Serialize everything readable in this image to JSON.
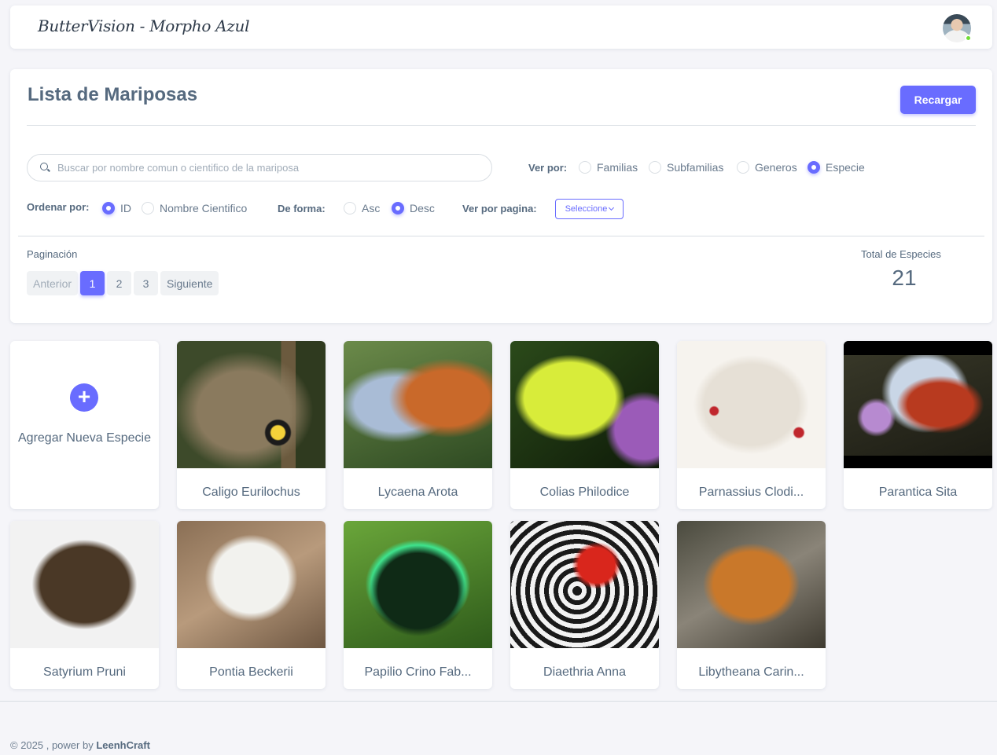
{
  "navbar": {
    "brand": "ButterVision - Morpho Azul"
  },
  "card": {
    "title": "Lista de Mariposas",
    "reload_label": "Recargar",
    "search_placeholder": "Buscar por nombre comun o cientifico de la mariposa",
    "search_value": "",
    "view_by": {
      "label": "Ver por:",
      "options": [
        "Familias",
        "Subfamilias",
        "Generos",
        "Especie"
      ],
      "selected": "Especie"
    },
    "order_by": {
      "label": "Ordenar por:",
      "options": [
        "ID",
        "Nombre Cientifico"
      ],
      "selected": "ID"
    },
    "direction": {
      "label": "De forma:",
      "options": [
        "Asc",
        "Desc"
      ],
      "selected": "Desc"
    },
    "per_page": {
      "label": "Ver por pagina:",
      "select_value": "Seleccione"
    },
    "pagination": {
      "label": "Paginación",
      "prev": "Anterior",
      "pages": [
        "1",
        "2",
        "3"
      ],
      "current": "1",
      "next": "Siguiente"
    },
    "total": {
      "label": "Total de Especies",
      "value": "21"
    }
  },
  "add_tile": {
    "label": "Agregar Nueva Especie",
    "icon": "plus-icon"
  },
  "species": [
    "Caligo Eurilochus",
    "Lycaena Arota",
    "Colias Philodice",
    "Parnassius Clodi...",
    "Parantica Sita",
    "Satyrium Pruni",
    "Pontia Beckerii",
    "Papilio Crino Fab...",
    "Diaethria Anna",
    "Libytheana Carin..."
  ],
  "footer": {
    "copyright": "© 2025 , power by",
    "author": "LeenhCraft"
  },
  "colors": {
    "primary": "#696cff",
    "text": "#566a7f",
    "background": "#f5f5f9",
    "status_online": "#71dd37"
  }
}
